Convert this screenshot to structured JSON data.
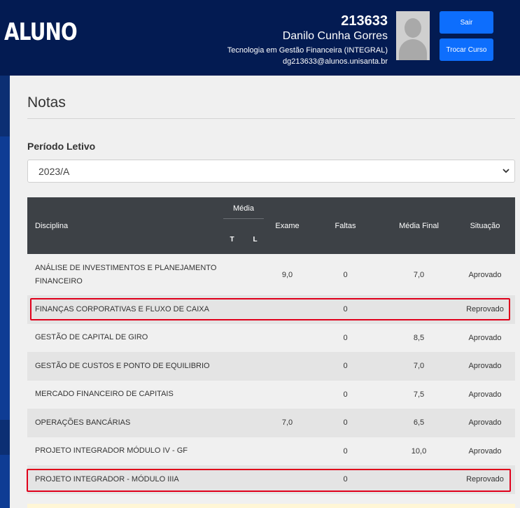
{
  "header": {
    "brand": "ALUNO",
    "user_id": "213633",
    "user_name": "Danilo Cunha Gorres",
    "course": "Tecnologia em Gestão Financeira (INTEGRAL)",
    "email": "dg213633@alunos.unisanta.br",
    "logout_label": "Sair",
    "change_course_label": "Trocar Curso"
  },
  "page": {
    "title": "Notas",
    "period_label": "Período Letivo",
    "period_value": "2023/A"
  },
  "table": {
    "headers": {
      "disciplina": "Disciplina",
      "media": "Média",
      "media_t": "T",
      "media_l": "L",
      "exame": "Exame",
      "faltas": "Faltas",
      "media_final": "Média Final",
      "situacao": "Situação"
    },
    "rows": [
      {
        "disciplina": "ANÁLISE DE INVESTIMENTOS E PLANEJAMENTO FINANCEIRO",
        "t": "",
        "l": "",
        "exame": "9,0",
        "faltas": "0",
        "media_final": "7,0",
        "situacao": "Aprovado"
      },
      {
        "disciplina": "FINANÇAS CORPORATIVAS E FLUXO DE CAIXA",
        "t": "",
        "l": "",
        "exame": "",
        "faltas": "0",
        "media_final": "",
        "situacao": "Reprovado"
      },
      {
        "disciplina": "GESTÃO DE CAPITAL DE GIRO",
        "t": "",
        "l": "",
        "exame": "",
        "faltas": "0",
        "media_final": "8,5",
        "situacao": "Aprovado"
      },
      {
        "disciplina": "GESTÃO DE CUSTOS E PONTO DE EQUILIBRIO",
        "t": "",
        "l": "",
        "exame": "",
        "faltas": "0",
        "media_final": "7,0",
        "situacao": "Aprovado"
      },
      {
        "disciplina": "MERCADO FINANCEIRO DE CAPITAIS",
        "t": "",
        "l": "",
        "exame": "",
        "faltas": "0",
        "media_final": "7,5",
        "situacao": "Aprovado"
      },
      {
        "disciplina": "OPERAÇÕES BANCÁRIAS",
        "t": "",
        "l": "",
        "exame": "7,0",
        "faltas": "0",
        "media_final": "6,5",
        "situacao": "Aprovado"
      },
      {
        "disciplina": "PROJETO INTEGRADOR MÓDULO IV - GF",
        "t": "",
        "l": "",
        "exame": "",
        "faltas": "0",
        "media_final": "10,0",
        "situacao": "Aprovado"
      },
      {
        "disciplina": "PROJETO INTEGRADOR - MÓDULO IIIA",
        "t": "",
        "l": "",
        "exame": "",
        "faltas": "0",
        "media_final": "",
        "situacao": "Reprovado"
      }
    ]
  },
  "colors": {
    "header_bg": "#031b52",
    "button": "#0d6efd",
    "table_header": "#3d4146",
    "highlight": "#e0001b"
  }
}
